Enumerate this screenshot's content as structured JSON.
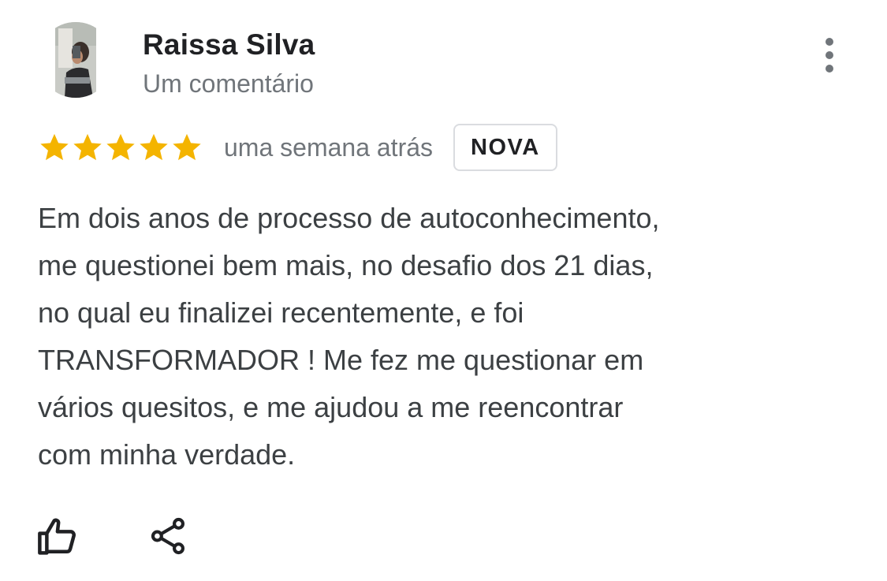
{
  "review": {
    "author": {
      "name": "Raissa Silva",
      "meta": "Um comentário"
    },
    "rating": 5,
    "max_rating": 5,
    "time_ago": "uma semana atrás",
    "badge": "NOVA",
    "text_lines": [
      "Em dois anos de processo de autoconhecimento,",
      "me questionei bem mais, no desafio dos 21 dias,",
      "no qual eu finalizei recentemente, e foi",
      "TRANSFORMADOR ! Me fez me questionar em",
      "vários quesitos, e me ajudou a me reencontrar",
      "com minha verdade."
    ]
  },
  "icons": {
    "more": "more-vertical-icon",
    "star": "star-icon",
    "like": "thumb-up-icon",
    "share": "share-icon"
  },
  "colors": {
    "star": "#f4b400",
    "name": "#202124",
    "muted": "#70757a",
    "body": "#3c4043",
    "badge_border": "#dadce0"
  }
}
